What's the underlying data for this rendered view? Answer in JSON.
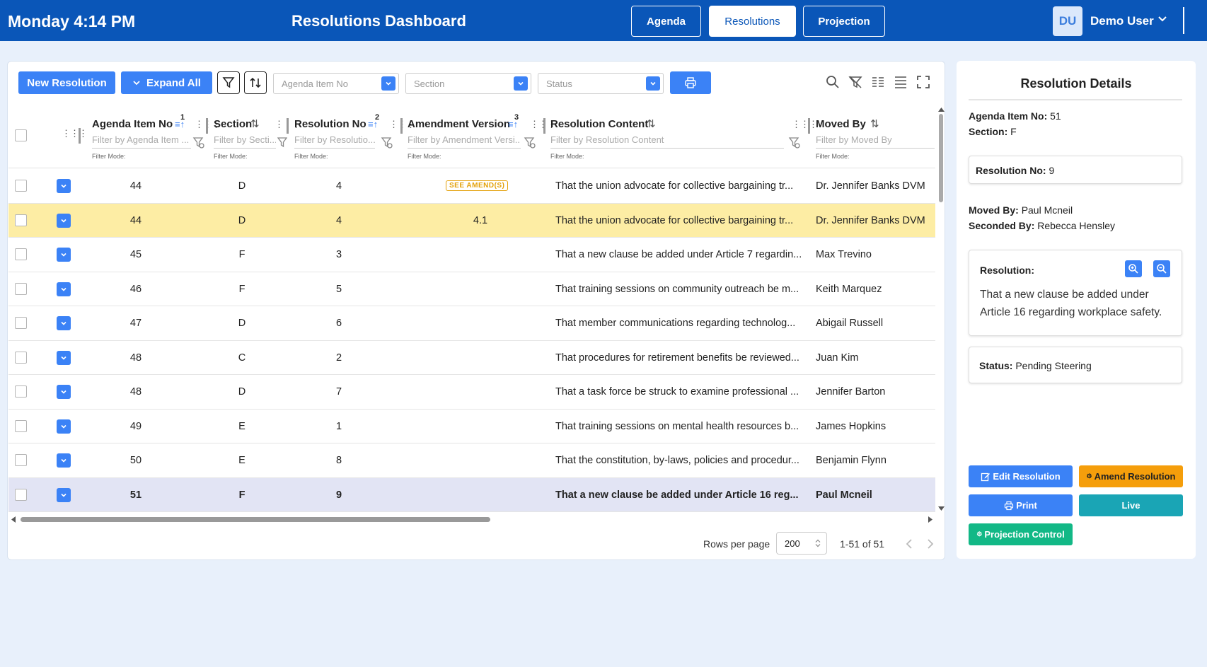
{
  "header": {
    "time": "Monday 4:14 PM",
    "title": "Resolutions Dashboard",
    "nav": [
      "Agenda",
      "Resolutions",
      "Projection"
    ],
    "active_nav": "Resolutions",
    "avatar_initials": "DU",
    "user_name": "Demo User"
  },
  "toolbar": {
    "new_resolution": "New Resolution",
    "expand_all": "Expand All",
    "agenda_placeholder": "Agenda Item No",
    "section_placeholder": "Section",
    "status_placeholder": "Status"
  },
  "table": {
    "columns": [
      {
        "label": "Agenda Item No",
        "sort_index": "1",
        "filter": "Filter by Agenda Item ...",
        "mode": "Filter Mode:"
      },
      {
        "label": "Section",
        "filter": "Filter by Secti...",
        "mode": "Filter Mode:"
      },
      {
        "label": "Resolution No",
        "sort_index": "2",
        "filter": "Filter by Resolutio...",
        "mode": "Filter Mode:"
      },
      {
        "label": "Amendment Version",
        "sort_index": "3",
        "filter": "Filter by Amendment Versi...",
        "mode": "Filter Mode:"
      },
      {
        "label": "Resolution Content",
        "filter": "Filter by Resolution Content",
        "mode": "Filter Mode:"
      },
      {
        "label": "Moved By",
        "filter": "Filter by Moved By",
        "mode": "Filter Mode:"
      }
    ],
    "amend_badge": "SEE AMEND(S)",
    "rows": [
      {
        "agenda": "44",
        "section": "D",
        "res": "4",
        "amend": "",
        "content": "That the union advocate for collective bargaining tr...",
        "moved": "Dr. Jennifer Banks DVM"
      },
      {
        "agenda": "44",
        "section": "D",
        "res": "4",
        "amend": "4.1",
        "content": "That the union advocate for collective bargaining tr...",
        "moved": "Dr. Jennifer Banks DVM"
      },
      {
        "agenda": "45",
        "section": "F",
        "res": "3",
        "amend": "",
        "content": "That a new clause be added under Article 7 regardin...",
        "moved": "Max Trevino"
      },
      {
        "agenda": "46",
        "section": "F",
        "res": "5",
        "amend": "",
        "content": "That training sessions on community outreach be m...",
        "moved": "Keith Marquez"
      },
      {
        "agenda": "47",
        "section": "D",
        "res": "6",
        "amend": "",
        "content": "That member communications regarding technolog...",
        "moved": "Abigail Russell"
      },
      {
        "agenda": "48",
        "section": "C",
        "res": "2",
        "amend": "",
        "content": "That procedures for retirement benefits be reviewed...",
        "moved": "Juan Kim"
      },
      {
        "agenda": "48",
        "section": "D",
        "res": "7",
        "amend": "",
        "content": "That a task force be struck to examine professional ...",
        "moved": "Jennifer Barton"
      },
      {
        "agenda": "49",
        "section": "E",
        "res": "1",
        "amend": "",
        "content": "That training sessions on mental health resources b...",
        "moved": "James Hopkins"
      },
      {
        "agenda": "50",
        "section": "E",
        "res": "8",
        "amend": "",
        "content": "That the constitution, by-laws, policies and procedur...",
        "moved": "Benjamin Flynn"
      },
      {
        "agenda": "51",
        "section": "F",
        "res": "9",
        "amend": "",
        "content": "That a new clause be added under Article 16 reg...",
        "moved": "Paul Mcneil"
      }
    ]
  },
  "pagination": {
    "rows_per_page_label": "Rows per page",
    "rows_per_page": "200",
    "range": "1-51 of 51"
  },
  "details": {
    "title": "Resolution Details",
    "agenda_label": "Agenda Item No:",
    "agenda_value": "51",
    "section_label": "Section:",
    "section_value": "F",
    "res_no_label": "Resolution No:",
    "res_no_value": "9",
    "moved_label": "Moved By:",
    "moved_value": "Paul Mcneil",
    "seconded_label": "Seconded By:",
    "seconded_value": "Rebecca Hensley",
    "resolution_label": "Resolution:",
    "resolution_text": "That a new clause be added under Article 16 regarding workplace safety.",
    "status_label": "Status:",
    "status_value": "Pending Steering",
    "buttons": {
      "edit": "Edit Resolution",
      "amend": "Amend Resolution",
      "print": "Print",
      "live": "Live",
      "projection": "Projection Control"
    }
  },
  "colors": {
    "header_bg": "#0a56b8",
    "primary": "#3b82f6",
    "amend_orange": "#f59e0b",
    "live_teal": "#1aa5b5",
    "projection_green": "#12b886",
    "highlight_row": "#fdeda4",
    "selected_row": "#e2e4f4"
  }
}
